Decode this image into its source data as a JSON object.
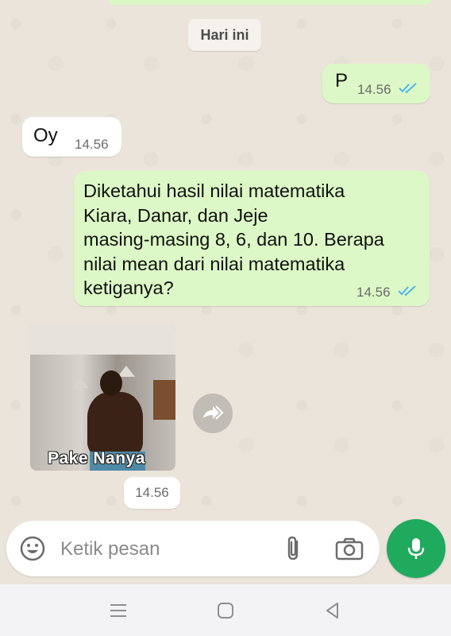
{
  "date_chip": "Hari ini",
  "messages": [
    {
      "text": "P",
      "time": "14.56",
      "direction": "outgoing",
      "status": "read"
    },
    {
      "text": "Oy",
      "time": "14.56",
      "direction": "incoming"
    },
    {
      "text": "Diketahui hasil nilai matematika\nKiara, Danar, dan Jeje\nmasing-masing 8, 6, dan 10. Berapa\nnilai mean dari nilai matematika\nketiganya?",
      "time": "14.56",
      "direction": "outgoing",
      "status": "read"
    }
  ],
  "sticker": {
    "caption": "Pake Nanya",
    "time": "14.56"
  },
  "input": {
    "placeholder": "Ketik pesan",
    "value": ""
  },
  "colors": {
    "outgoing_bubble": "#dcf8c6",
    "incoming_bubble": "#ffffff",
    "read_tick": "#4fb6ec",
    "mic_button": "#1faa5d",
    "chat_background": "#ebe4da"
  },
  "icons": [
    "double-check-icon",
    "forward-icon",
    "emoji-icon",
    "paperclip-icon",
    "camera-icon",
    "microphone-icon",
    "recents-icon",
    "home-icon",
    "back-icon"
  ]
}
